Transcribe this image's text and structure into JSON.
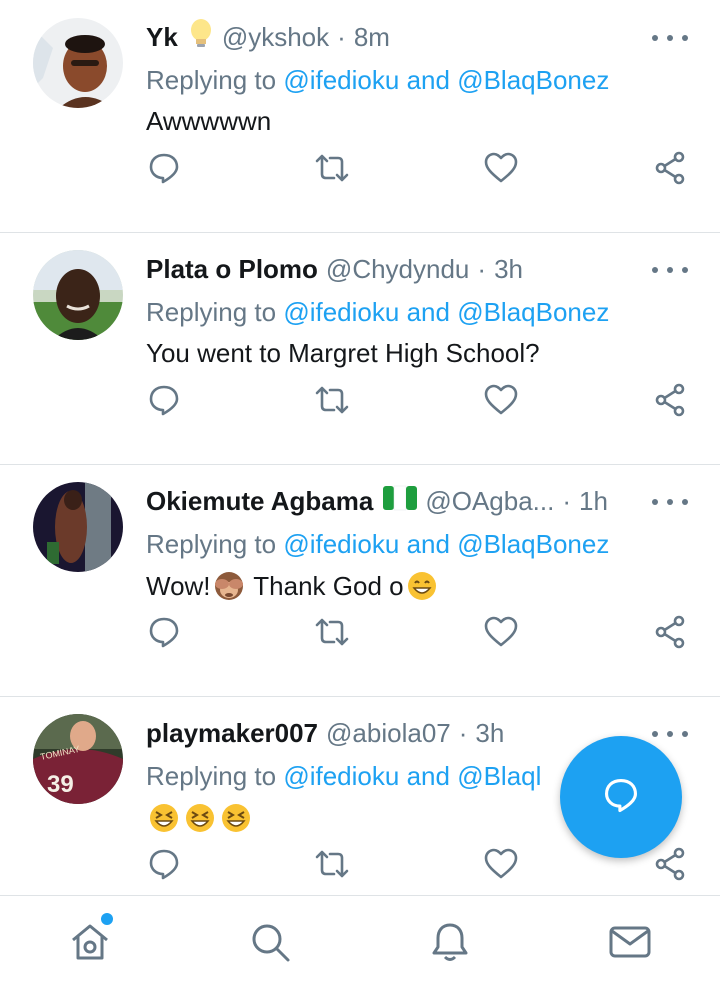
{
  "tweets": [
    {
      "name": "Yk",
      "badge": "💡",
      "handle": "@ykshok",
      "time": "8m",
      "replying_prefix": "Replying to",
      "mention1": "@ifedioku",
      "and_word": "and",
      "mention2": "@BlaqBonez",
      "text": "Awwwwwn",
      "avatar": "avatar-man-white-background"
    },
    {
      "name": "Plata o Plomo",
      "handle": "@Chydyndu",
      "time": "3h",
      "replying_prefix": "Replying to",
      "mention1": "@ifedioku",
      "and_word": "and",
      "mention2": "@BlaqBonez",
      "text": "You went to Margret High School?",
      "avatar": "avatar-man-green-field"
    },
    {
      "name": "Okiemute Agbama",
      "flag": "nigeria-flag",
      "handle": "@OAgba...",
      "time": "1h",
      "replying_prefix": "Replying to",
      "mention1": "@ifedioku",
      "and_word": "and",
      "mention2": "@BlaqBonez",
      "text_part1": "Wow!",
      "emoji1": "see-no-evil-monkey",
      "text_part2": " Thank God o",
      "emoji2": "grinning-face-with-smiling-eyes",
      "avatar": "avatar-figure-dark"
    },
    {
      "name": "playmaker007",
      "handle": "@abiola07",
      "time": "3h",
      "replying_prefix": "Replying to",
      "mention1": "@ifedioku",
      "and_word": "and",
      "mention2": "@Blaql",
      "emojis": [
        "grinning-squinting-face",
        "grinning-squinting-face",
        "grinning-squinting-face"
      ],
      "avatar": "avatar-footballer-jersey",
      "jersey_number": "39",
      "jersey_name": "TOMINAY"
    }
  ],
  "actions": [
    "reply-icon",
    "retweet-icon",
    "like-icon",
    "share-icon"
  ],
  "fab": {
    "icon": "compose-reply-icon"
  },
  "bottom_nav": [
    "home-icon",
    "search-icon",
    "notifications-icon",
    "messages-icon"
  ],
  "colors": {
    "accent": "#1da1f2",
    "text": "#14171a",
    "secondary": "#657786",
    "divider": "#dfe3e6"
  }
}
